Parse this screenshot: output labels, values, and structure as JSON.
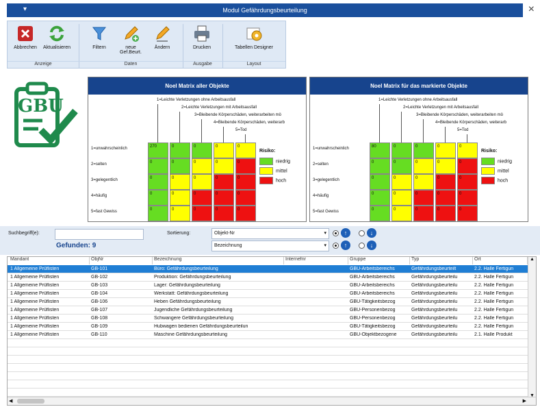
{
  "window": {
    "title": "Modul Gefährdungsbeurteilung",
    "close": "×",
    "menu_glyph": "▾"
  },
  "ribbon": {
    "buttons": [
      {
        "label": "Abbrechen",
        "icon": "cancel-x-icon"
      },
      {
        "label": "Aktualisieren",
        "icon": "refresh-icon"
      },
      {
        "label": "Filtern",
        "icon": "filter-funnel-icon"
      },
      {
        "label": "neue Gef.Beurt.",
        "icon": "new-pencil-icon"
      },
      {
        "label": "Ändern",
        "icon": "edit-pencil-icon"
      },
      {
        "label": "Drucken",
        "icon": "printer-icon"
      },
      {
        "label": "Tabellen Designer",
        "icon": "table-designer-gear-icon"
      }
    ],
    "groups": [
      {
        "label": "Anzeige"
      },
      {
        "label": "Daten"
      },
      {
        "label": "Ausgabe"
      },
      {
        "label": "Layout"
      }
    ]
  },
  "logo": {
    "text": "GBU"
  },
  "matrix_left": {
    "title": "Noel Matrix aller Objekte"
  },
  "matrix_right": {
    "title": "Noel Matrix für das markierte Objekte"
  },
  "matrix_columns": [
    "1=Leichte Verletzungen ohne Arbeitsausfall",
    "2=Leichte Verletzungen mit Arbeitsausfall",
    "3=Bleibende Körperschäden, weiterarbeiten mö",
    "4=Bleibende Körperschäden, weiterarb",
    "5=Tod"
  ],
  "matrix_rows": [
    "1=unwahrscheinlich",
    "2=selten",
    "3=gelegentlich",
    "4=häufig",
    "5=fast Gewiss"
  ],
  "matrix_colors": {
    "green": "#66dd22",
    "yellow": "#ffff00",
    "red": "#ee1111"
  },
  "matrix_grid": [
    [
      "green",
      "green",
      "green",
      "yellow",
      "yellow"
    ],
    [
      "green",
      "green",
      "yellow",
      "yellow",
      "red"
    ],
    [
      "green",
      "yellow",
      "yellow",
      "red",
      "red"
    ],
    [
      "green",
      "yellow",
      "red",
      "red",
      "red"
    ],
    [
      "green",
      "yellow",
      "red",
      "red",
      "red"
    ]
  ],
  "matrix_left_values": [
    [
      "270",
      "0",
      "0",
      "0",
      "0"
    ],
    [
      "0",
      "0",
      "0",
      "0",
      "0"
    ],
    [
      "0",
      "0",
      "0",
      "0",
      "0"
    ],
    [
      "0",
      "0",
      "0",
      "0",
      "0"
    ],
    [
      "0",
      "0",
      "0",
      "0",
      "0"
    ]
  ],
  "matrix_right_values": [
    [
      "80",
      "0",
      "0",
      "0",
      "0"
    ],
    [
      "0",
      "0",
      "0",
      "0",
      "0"
    ],
    [
      "0",
      "0",
      "0",
      "0",
      "0"
    ],
    [
      "0",
      "0",
      "0",
      "0",
      "0"
    ],
    [
      "0",
      "0",
      "0",
      "0",
      "0"
    ]
  ],
  "legend": {
    "title": "Risiko:",
    "items": [
      {
        "label": "niedrig",
        "color": "#66dd22"
      },
      {
        "label": "mittel",
        "color": "#ffff00"
      },
      {
        "label": "hoch",
        "color": "#ee1111"
      }
    ]
  },
  "search": {
    "label": "Suchbegriff(e):",
    "value": "",
    "found": "Gefunden: 9",
    "sort_label": "Sortierung:",
    "sort1": "Objekt-Nr",
    "sort2": "Bezeichnung"
  },
  "grid": {
    "columns": [
      "Mandant",
      "ObjNr",
      "Bezeichnung",
      "Internefnr",
      "Gruppe",
      "Typ",
      "Ort"
    ],
    "rows": [
      [
        "1 Allgemeine Prüflisten",
        "GB-101",
        "Büro: Gefährdungsbeurteilung",
        "",
        "GBU-Arbeitsbereichs",
        "Gefährdungsbeurteilt",
        "2.2. Halle Fertigun"
      ],
      [
        "1 Allgemeine Prüflisten",
        "GB-102",
        "Produktion: Gefährdungsbeurteilung",
        "",
        "GBU-Arbeitsbereichs",
        "Gefährdungsbeurteilu",
        "2.2. Halle Fertigun"
      ],
      [
        "1 Allgemeine Prüflisten",
        "GB-103",
        "Lager: Gefährdungsbeurteilung",
        "",
        "GBU-Arbeitsbereichs",
        "Gefährdungsbeurteilu",
        "2.2. Halle Fertigun"
      ],
      [
        "1 Allgemeine Prüflisten",
        "GB-104",
        "Werkstatt: Gefährdungsbeurteilung",
        "",
        "GBU-Arbeitsbereichs",
        "Gefährdungsbeurteilu",
        "2.2. Halle Fertigun"
      ],
      [
        "1 Allgemeine Prüflisten",
        "GB-106",
        "Heben Gefährdungsbeurteilung",
        "",
        "GBU-Tätigkeitsbezog",
        "Gefährdungsbeurteilu",
        "2.2. Halle Fertigun"
      ],
      [
        "1 Allgemeine Prüflisten",
        "GB-107",
        "Jugendliche Gefährdungsbeurteilung",
        "",
        "GBU-Personenbezog",
        "Gefährdungsbeurteilu",
        "2.2. Halle Fertigun"
      ],
      [
        "1 Allgemeine Prüflisten",
        "GB-108",
        "Schwangere Gefährdungsbeurteilung",
        "",
        "GBU-Personenbezog",
        "Gefährdungsbeurteilu",
        "2.2. Halle Fertigun"
      ],
      [
        "1 Allgemeine Prüflisten",
        "GB-109",
        "Hubwagen bedienen Gefährdungsbeurteilun",
        "",
        "GBU-Tätigkeitsbezog",
        "Gefährdungsbeurteilu",
        "2.2. Halle Fertigun"
      ],
      [
        "1 Allgemeine Prüflisten",
        "GB-110",
        "Maschine Gefährdungsbeurteilung",
        "",
        "GBU-Objektbezogene",
        "Gefährdungsbeurteilu",
        "2.1. Halle Produkt"
      ]
    ]
  }
}
